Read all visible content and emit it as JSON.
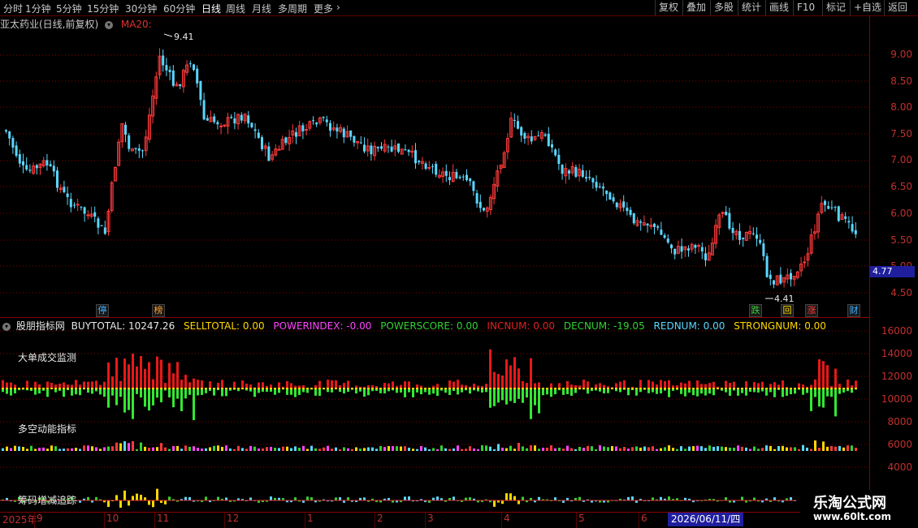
{
  "toolbar": {
    "periods": [
      "分时",
      "1分钟",
      "5分钟",
      "15分钟",
      "30分钟",
      "60分钟",
      "日线",
      "周线",
      "月线",
      "多周期",
      "更多"
    ],
    "active_period": "日线",
    "tools": [
      "复权",
      "叠加",
      "多股",
      "统计",
      "画线",
      "F10",
      "标记",
      "+自选",
      "返回"
    ]
  },
  "stock": {
    "title": "亚太药业(日线,前复权)",
    "ma_label": "MA20:"
  },
  "price_axis": [
    "9.00",
    "8.50",
    "8.00",
    "7.50",
    "7.00",
    "6.50",
    "6.00",
    "5.50",
    "5.00",
    "4.50"
  ],
  "current_price": "4.77",
  "markers": {
    "high": "9.41",
    "low": "4.41"
  },
  "badges": [
    {
      "text": "停",
      "color": "#3ab0ff"
    },
    {
      "text": "榜",
      "color": "#ff9d2a"
    },
    {
      "text": "跌",
      "color": "#32d232"
    },
    {
      "text": "回",
      "color": "#ffd700"
    },
    {
      "text": "涨",
      "color": "#ff3a3a"
    },
    {
      "text": "财",
      "color": "#3ab0ff"
    }
  ],
  "indicator": {
    "name": "股朋指标网",
    "values": [
      {
        "text": "BUYTOTAL: 10247.26",
        "color": "#e8e8e8"
      },
      {
        "text": "SELLTOTAL: 0.00",
        "color": "#ffd700"
      },
      {
        "text": "POWERINDEX: -0.00",
        "color": "#ff44ff"
      },
      {
        "text": "POWERSCORE: 0.00",
        "color": "#32d232"
      },
      {
        "text": "INCNUM: 0.00",
        "color": "#e02020"
      },
      {
        "text": "DECNUM: -19.05",
        "color": "#32d232"
      },
      {
        "text": "REDNUM: 0.00",
        "color": "#5ad7ff"
      },
      {
        "text": "STRONGNUM: 0.00",
        "color": "#ffd700"
      }
    ],
    "axis": [
      "16000",
      "14000",
      "12000",
      "10000",
      "8000",
      "6000",
      "4000"
    ],
    "annotations": [
      "大单成交监测",
      "多空动能指标",
      "筹码增减追踪"
    ]
  },
  "dates": [
    {
      "text": "2025年"
    },
    {
      "text": "9"
    },
    {
      "text": "10"
    },
    {
      "text": "11"
    },
    {
      "text": "12"
    },
    {
      "text": "1"
    },
    {
      "text": "2"
    },
    {
      "text": "3"
    },
    {
      "text": "4"
    },
    {
      "text": "5"
    },
    {
      "text": "6"
    }
  ],
  "cursor_date": "2026/06/11/四",
  "watermark": {
    "main": "乐淘公式网",
    "url": "www.60lt.com"
  },
  "colors": {
    "up": "#ff3a3a",
    "down": "#5ad7ff",
    "ma": "#e03030",
    "grid": "#8b0000"
  }
}
